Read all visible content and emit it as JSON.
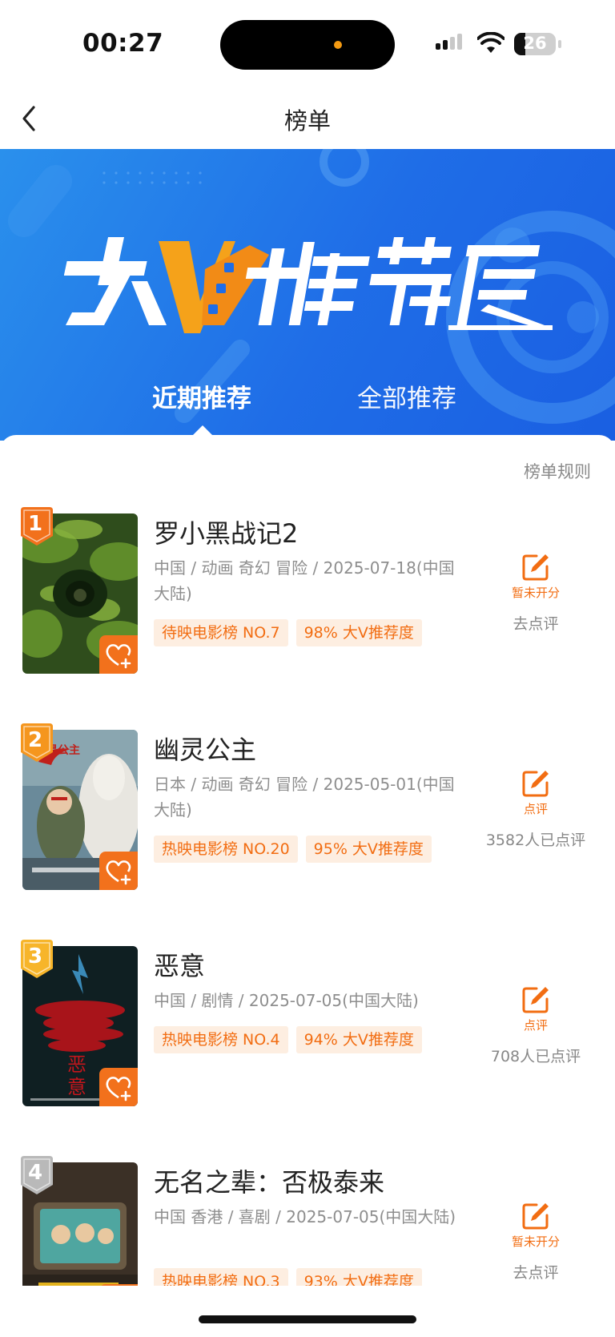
{
  "status_bar": {
    "time": "00:27",
    "battery_level": "26"
  },
  "nav": {
    "title": "榜单"
  },
  "banner": {
    "logo_text": "大V推荐度",
    "tabs": [
      {
        "label": "近期推荐",
        "active": true
      },
      {
        "label": "全部推荐",
        "active": false
      }
    ]
  },
  "content": {
    "rules_link": "榜单规则",
    "movies": [
      {
        "rank": "1",
        "title": "罗小黑战记2",
        "meta": "中国 / 动画 奇幻 冒险 / 2025-07-18(中国大陆)",
        "tags": [
          "待映电影榜 NO.7",
          "98% 大V推荐度"
        ],
        "rate_label": "暂未开分",
        "rate_count": "去点评"
      },
      {
        "rank": "2",
        "title": "幽灵公主",
        "meta": "日本 / 动画 奇幻 冒险 / 2025-05-01(中国大陆)",
        "tags": [
          "热映电影榜 NO.20",
          "95% 大V推荐度"
        ],
        "rate_label": "点评",
        "rate_count": "3582人已点评"
      },
      {
        "rank": "3",
        "title": "恶意",
        "meta": "中国 / 剧情 / 2025-07-05(中国大陆)",
        "tags": [
          "热映电影榜 NO.4",
          "94% 大V推荐度"
        ],
        "rate_label": "点评",
        "rate_count": "708人已点评"
      },
      {
        "rank": "4",
        "title": "无名之辈：否极泰来",
        "meta": "中国 香港 / 喜剧 / 2025-07-05(中国大陆)",
        "tags": [
          "热映电影榜 NO.3",
          "93% 大V推荐度"
        ],
        "rate_label": "暂未开分",
        "rate_count": "去点评"
      }
    ]
  },
  "colors": {
    "accent": "#f26d12",
    "banner_blue": "#1f6de7",
    "tag_bg": "#fdeee1",
    "rank_1": "#f2711c",
    "rank_2": "#f5961e",
    "rank_3": "#f7b52a",
    "rank_4": "#b9b9b9"
  },
  "icons": [
    "back-icon",
    "heart-plus-icon",
    "edit-icon",
    "wifi-icon",
    "signal-icon",
    "battery-icon"
  ]
}
